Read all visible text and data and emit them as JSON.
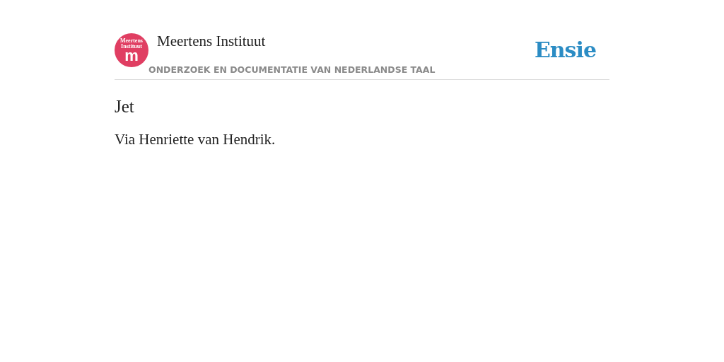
{
  "header": {
    "logo": {
      "line_1": "Meertens",
      "line_2": "Instituut",
      "letter": "m"
    },
    "title": "Meertens Instituut",
    "subtitle": "ONDERZOEK EN DOCUMENTATIE VAN NEDERLANDSE TAAL",
    "brand": "Ensie"
  },
  "article": {
    "heading": "Jet",
    "body": "Via Henriette van Hendrik."
  }
}
